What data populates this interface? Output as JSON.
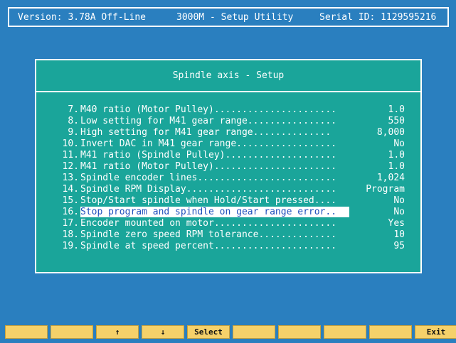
{
  "header": {
    "version": "Version: 3.78A Off-Line",
    "app_title": "3000M - Setup Utility",
    "serial": "Serial ID: 1129595216"
  },
  "dialog": {
    "title": "Spindle axis - Setup",
    "selected_index": 9,
    "items": [
      {
        "num": "7.",
        "label": "M40 ratio (Motor Pulley)......................",
        "value": "1.0"
      },
      {
        "num": "8.",
        "label": "Low setting for M41 gear range................",
        "value": "550"
      },
      {
        "num": "9.",
        "label": "High setting for M41 gear range..............",
        "value": "8,000"
      },
      {
        "num": "10.",
        "label": "Invert DAC in M41 gear range..................",
        "value": "No"
      },
      {
        "num": "11.",
        "label": "M41 ratio (Spindle Pulley)....................",
        "value": "1.0"
      },
      {
        "num": "12.",
        "label": "M41 ratio (Motor Pulley)......................",
        "value": "1.0"
      },
      {
        "num": "13.",
        "label": "Spindle encoder lines.........................",
        "value": "1,024"
      },
      {
        "num": "14.",
        "label": "Spindle RPM Display...........................",
        "value": "Program"
      },
      {
        "num": "15.",
        "label": "Stop/Start spindle when Hold/Start pressed....",
        "value": "No"
      },
      {
        "num": "16.",
        "label": "Stop program and spindle on gear range error..",
        "value": "No"
      },
      {
        "num": "17.",
        "label": "Encoder mounted on motor......................",
        "value": "Yes"
      },
      {
        "num": "18.",
        "label": "Spindle zero speed RPM tolerance..............",
        "value": "10"
      },
      {
        "num": "19.",
        "label": "Spindle at speed percent......................",
        "value": "95"
      }
    ]
  },
  "function_keys": [
    "",
    "",
    "↑",
    "↓",
    "Select",
    "",
    "",
    "",
    "",
    "Exit"
  ],
  "colors": {
    "background": "#2a7fbf",
    "dialog": "#1aa59a",
    "highlight_text": "#1f4fbd",
    "fkey": "#f5d16a"
  }
}
